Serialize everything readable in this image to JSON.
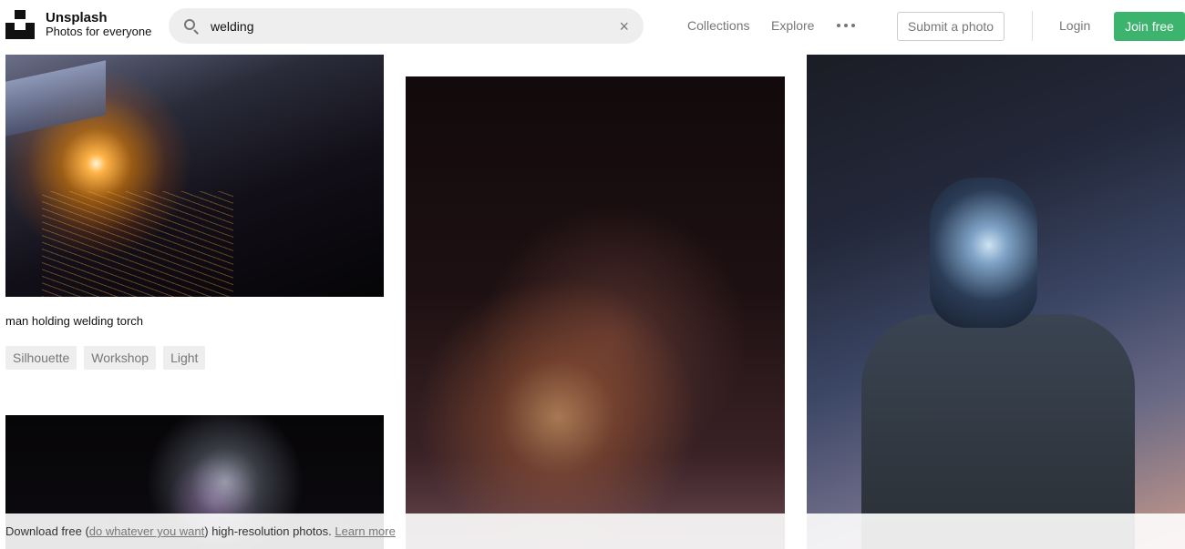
{
  "header": {
    "brand_name": "Unsplash",
    "brand_tagline": "Photos for everyone",
    "search": {
      "value": "welding",
      "placeholder": ""
    },
    "nav": {
      "collections": "Collections",
      "explore": "Explore"
    },
    "submit_label": "Submit a photo",
    "login_label": "Login",
    "join_label": "Join free",
    "colors": {
      "join": "#3cb46e",
      "search_bg": "#eeeeee"
    }
  },
  "photos": {
    "first": {
      "caption": "man holding welding torch",
      "tags": [
        "Silhouette",
        "Workshop",
        "Light"
      ]
    }
  },
  "footer_bar": {
    "prefix": "Download free (",
    "link": "do whatever you want",
    "middle": ") high-resolution photos.",
    "learn_more": "Learn more"
  }
}
